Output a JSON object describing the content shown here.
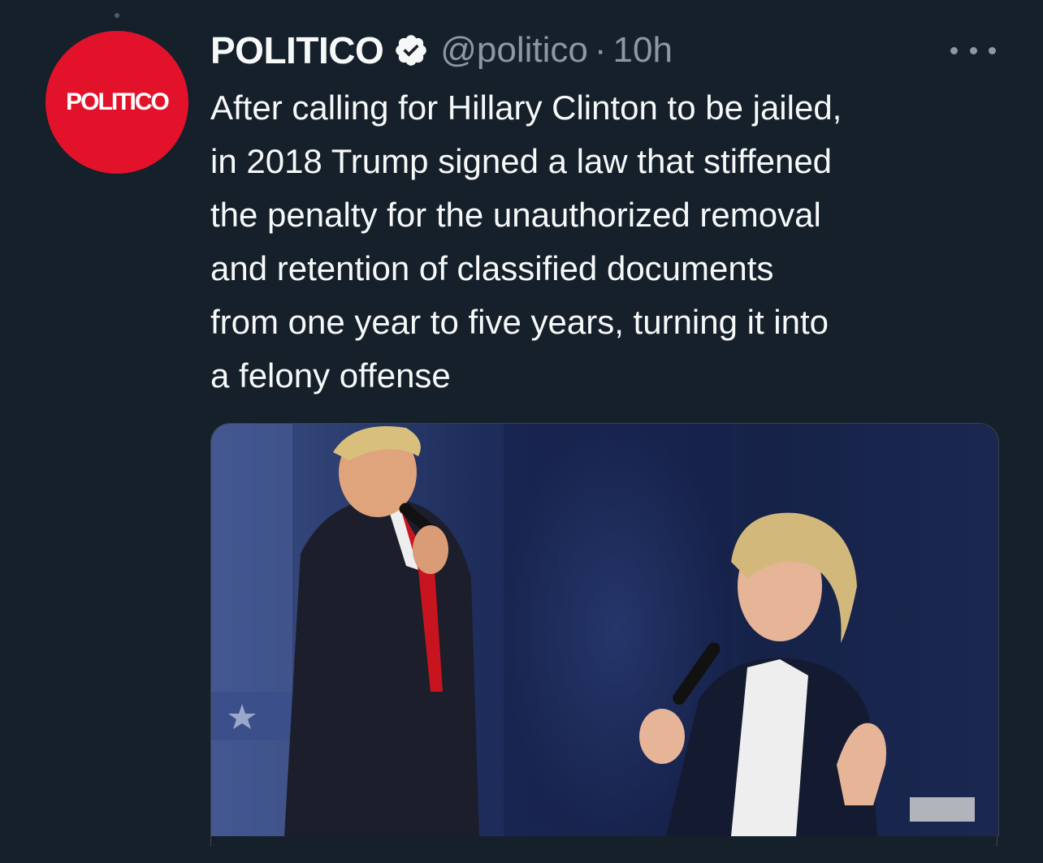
{
  "tweet": {
    "avatar_text": "POLITICO",
    "display_name": "POLITICO",
    "handle": "@politico",
    "separator": "·",
    "time": "10h",
    "text_lines": [
      "After calling for Hillary Clinton to be jailed,",
      "in 2018 Trump signed a law that stiffened",
      "the penalty for the unauthorized removal",
      "and retention of classified documents",
      "from one year to five years, turning it into",
      "a felony offense"
    ],
    "icons": {
      "verified": "verified-badge-icon",
      "more": "more-options-icon"
    },
    "colors": {
      "background": "#15202b",
      "avatar": "#e3122b",
      "secondary_text": "#8b98a5",
      "primary_text": "#f7f9f9"
    }
  }
}
